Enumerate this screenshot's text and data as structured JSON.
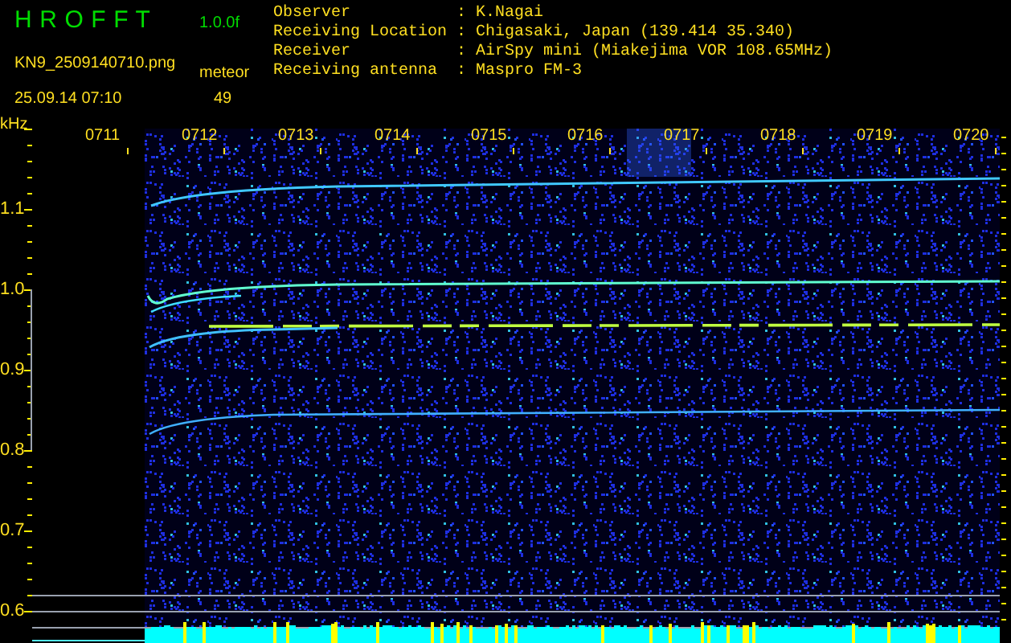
{
  "header": {
    "title": "H R O F F T",
    "version": "1.0.0f",
    "file_name": "KN9_2509140710.png",
    "count_label": "meteor",
    "timestamp": "25.09.14 07:10",
    "count": "49",
    "info": [
      {
        "label": "Observer",
        "separator": ":",
        "value": "K.Nagai"
      },
      {
        "label": "Receiving Location",
        "separator": ":",
        "value": "Chigasaki, Japan (139.414 35.340)"
      },
      {
        "label": "Receiver",
        "separator": ":",
        "value": "AirSpy mini (Miakejima VOR 108.65MHz)"
      },
      {
        "label": "Receiving antenna",
        "separator": ":",
        "value": "Maspro FM-3"
      }
    ]
  },
  "spectrogram": {
    "unit": "kHz",
    "time_labels": [
      "0711",
      "0712",
      "0713",
      "0714",
      "0715",
      "0716",
      "0717",
      "0718",
      "0719",
      "0720"
    ],
    "frequency_labels": [
      "1.1",
      "1.0",
      "0.9",
      "0.8",
      "0.7",
      "0.6"
    ]
  }
}
